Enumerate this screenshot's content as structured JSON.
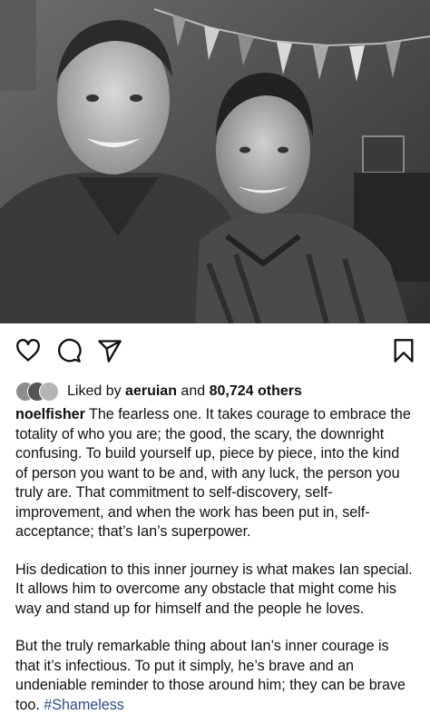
{
  "post": {
    "photo_alt": "photo",
    "likes": {
      "prefix": "Liked by",
      "user": "aeruian",
      "middle": "and",
      "count": "80,724 others"
    },
    "caption": {
      "username": "noelfisher",
      "p1": "The fearless one. It takes courage to embrace the totality of who you are; the good, the scary, the downright confusing. To build yourself up, piece by piece, into the kind of person you want to be and, with any luck, the person you truly are. That commitment to self-discovery, self-improvement, and when the work has been put in, self-acceptance; that’s Ian’s superpower.",
      "p2": "His dedication to this inner journey is what makes Ian special. It allows him to overcome any obstacle that might come his way and stand up for himself and the people he loves.",
      "p3": "But the truly remarkable thing about Ian’s inner courage is that it’s infectious. To put it simply, he’s brave and an undeniable reminder to those around him; they can be brave too.",
      "hashtag": "#Shameless"
    },
    "icons": [
      "heart-icon",
      "comment-icon",
      "share-icon",
      "bookmark-icon"
    ]
  }
}
